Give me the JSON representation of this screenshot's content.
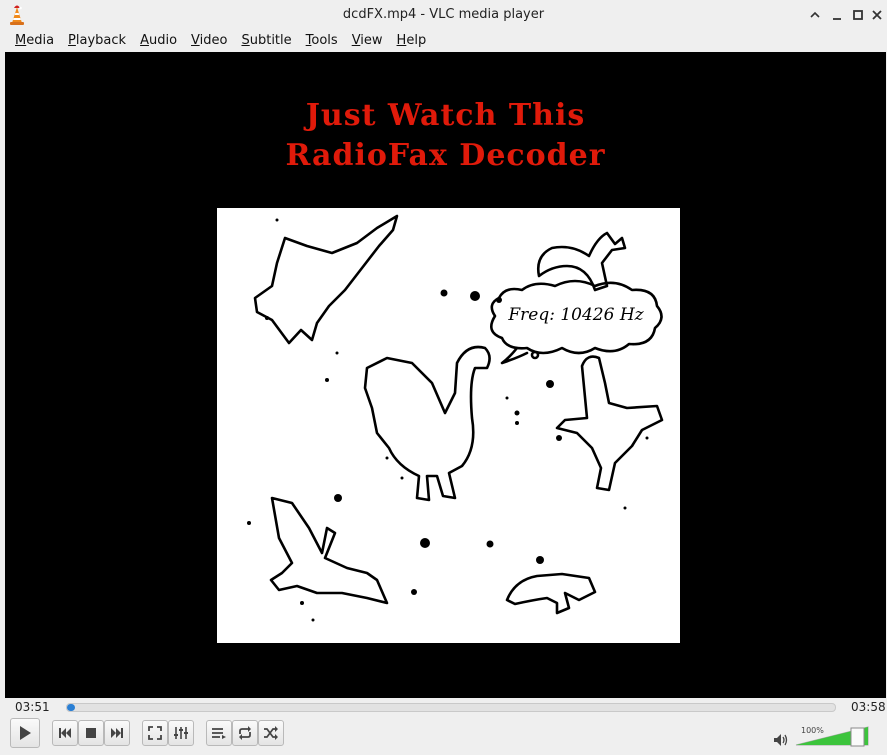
{
  "window": {
    "title": "dcdFX.mp4 - VLC media player"
  },
  "menu": [
    {
      "accel": "M",
      "rest": "edia"
    },
    {
      "accel": "P",
      "rest": "layback"
    },
    {
      "accel": "A",
      "rest": "udio"
    },
    {
      "accel": "V",
      "rest": "ideo"
    },
    {
      "accel": "S",
      "rest": "ubtitle"
    },
    {
      "accel": "T",
      "rest": "ools"
    },
    {
      "accel": "V",
      "rest": "iew"
    },
    {
      "accel": "H",
      "rest": "elp"
    }
  ],
  "video": {
    "title_line1": "Just Watch This",
    "title_line2": "RadioFax Decoder",
    "freq_label": "Freq: 10426 Hz"
  },
  "player": {
    "elapsed": "03:51",
    "total": "03:58",
    "progress_fraction": 0.005,
    "volume_label": "100%",
    "volume_fraction": 1.0
  },
  "icons": {
    "app": "vlc-cone-icon",
    "play": "play-icon",
    "prev": "previous-icon",
    "stop": "stop-icon",
    "next": "next-icon",
    "fullscreen": "fullscreen-icon",
    "extended": "equalizer-icon",
    "playlist": "playlist-icon",
    "loop": "loop-icon",
    "shuffle": "shuffle-icon",
    "volume": "speaker-icon"
  },
  "colors": {
    "video_title": "#e01a0a",
    "seek_fill": "#2a7fd4",
    "volume_fill": "#3cc43c"
  }
}
